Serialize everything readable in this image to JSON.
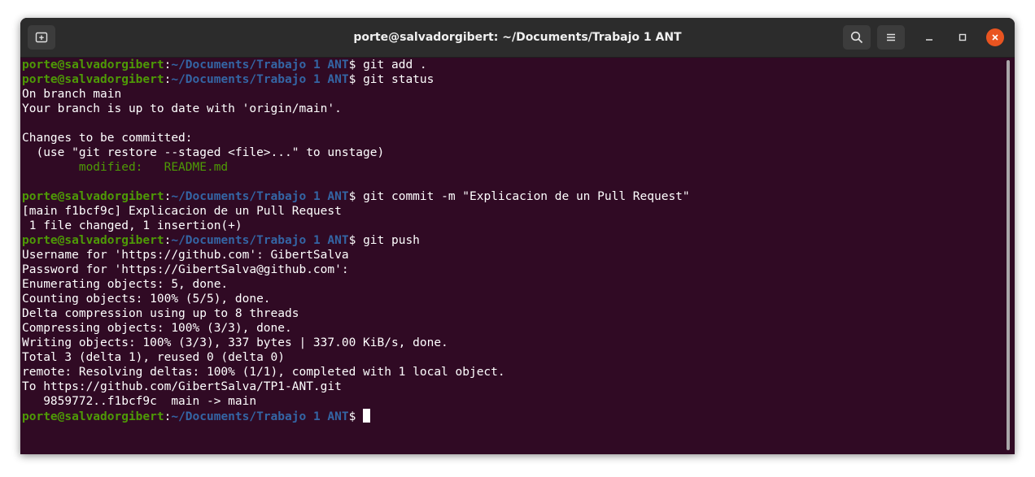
{
  "window": {
    "title": "porte@salvadorgibert: ~/Documents/Trabajo 1 ANT",
    "new_tab_icon": "new-tab-icon",
    "search_icon": "search-icon",
    "menu_icon": "hamburger-menu-icon",
    "minimize_icon": "minimize-icon",
    "maximize_icon": "maximize-icon",
    "close_icon": "close-icon"
  },
  "prompt": {
    "user_host": "porte@salvadorgibert",
    "sep": ":",
    "path": "~/Documents/Trabajo 1 ANT",
    "symbol": "$ "
  },
  "colors": {
    "background": "#300a24",
    "titlebar": "#2c2c2c",
    "user_host": "#4e9a06",
    "path": "#3465a4",
    "staged": "#4e9a06",
    "close": "#e95420"
  },
  "lines": [
    {
      "type": "prompt",
      "cmd": "git add ."
    },
    {
      "type": "prompt",
      "cmd": "git status"
    },
    {
      "type": "text",
      "text": "On branch main"
    },
    {
      "type": "text",
      "text": "Your branch is up to date with 'origin/main'."
    },
    {
      "type": "text",
      "text": ""
    },
    {
      "type": "text",
      "text": "Changes to be committed:"
    },
    {
      "type": "text",
      "text": "  (use \"git restore --staged <file>...\" to unstage)"
    },
    {
      "type": "green",
      "text": "        modified:   README.md"
    },
    {
      "type": "text",
      "text": ""
    },
    {
      "type": "prompt",
      "cmd": "git commit -m \"Explicacion de un Pull Request\""
    },
    {
      "type": "text",
      "text": "[main f1bcf9c] Explicacion de un Pull Request"
    },
    {
      "type": "text",
      "text": " 1 file changed, 1 insertion(+)"
    },
    {
      "type": "prompt",
      "cmd": "git push"
    },
    {
      "type": "text",
      "text": "Username for 'https://github.com': GibertSalva"
    },
    {
      "type": "text",
      "text": "Password for 'https://GibertSalva@github.com':"
    },
    {
      "type": "text",
      "text": "Enumerating objects: 5, done."
    },
    {
      "type": "text",
      "text": "Counting objects: 100% (5/5), done."
    },
    {
      "type": "text",
      "text": "Delta compression using up to 8 threads"
    },
    {
      "type": "text",
      "text": "Compressing objects: 100% (3/3), done."
    },
    {
      "type": "text",
      "text": "Writing objects: 100% (3/3), 337 bytes | 337.00 KiB/s, done."
    },
    {
      "type": "text",
      "text": "Total 3 (delta 1), reused 0 (delta 0)"
    },
    {
      "type": "text",
      "text": "remote: Resolving deltas: 100% (1/1), completed with 1 local object."
    },
    {
      "type": "text",
      "text": "To https://github.com/GibertSalva/TP1-ANT.git"
    },
    {
      "type": "text",
      "text": "   9859772..f1bcf9c  main -> main"
    },
    {
      "type": "prompt",
      "cmd": "",
      "cursor": true
    }
  ]
}
